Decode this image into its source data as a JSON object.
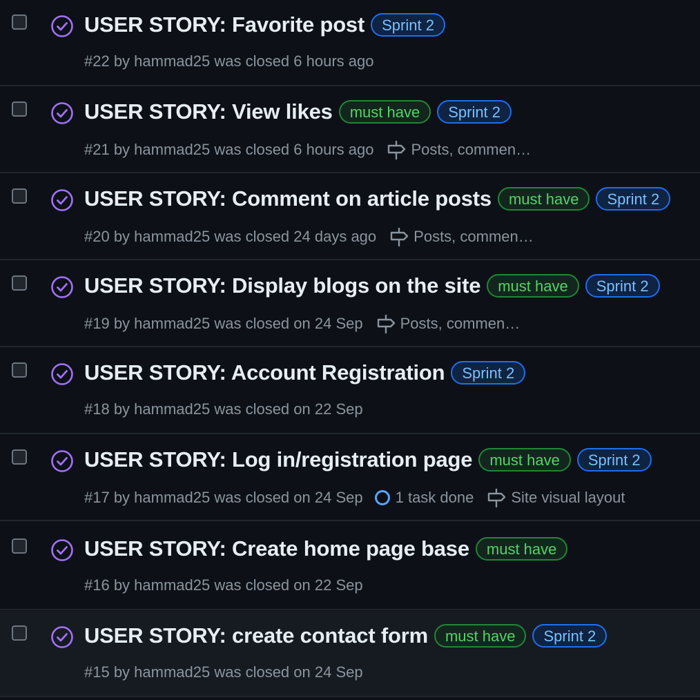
{
  "issues": [
    {
      "title": "USER STORY: Favorite post",
      "labels": [
        {
          "name": "Sprint 2",
          "color": "blue"
        }
      ],
      "meta": "#22 by hammad25 was closed 6 hours ago",
      "task": null,
      "milestone": null
    },
    {
      "title": "USER STORY: View likes",
      "labels": [
        {
          "name": "must have",
          "color": "green"
        },
        {
          "name": "Sprint 2",
          "color": "blue"
        }
      ],
      "meta": "#21 by hammad25 was closed 6 hours ago",
      "task": null,
      "milestone": "Posts, commen…"
    },
    {
      "title": "USER STORY: Comment on article posts",
      "labels": [
        {
          "name": "must have",
          "color": "green"
        },
        {
          "name": "Sprint 2",
          "color": "blue"
        }
      ],
      "meta": "#20 by hammad25 was closed 24 days ago",
      "task": null,
      "milestone": "Posts, commen…"
    },
    {
      "title": "USER STORY: Display blogs on the site",
      "labels": [
        {
          "name": "must have",
          "color": "green"
        },
        {
          "name": "Sprint 2",
          "color": "blue"
        }
      ],
      "meta": "#19 by hammad25 was closed on 24 Sep",
      "task": null,
      "milestone": "Posts, commen…"
    },
    {
      "title": "USER STORY: Account Registration",
      "labels": [
        {
          "name": "Sprint 2",
          "color": "blue"
        }
      ],
      "meta": "#18 by hammad25 was closed on 22 Sep",
      "task": null,
      "milestone": null
    },
    {
      "title": "USER STORY: Log in/registration page",
      "labels": [
        {
          "name": "must have",
          "color": "green"
        },
        {
          "name": "Sprint 2",
          "color": "blue"
        }
      ],
      "meta": "#17 by hammad25 was closed on 24 Sep",
      "task": "1 task done",
      "milestone": "Site visual layout"
    },
    {
      "title": "USER STORY: Create home page base",
      "labels": [
        {
          "name": "must have",
          "color": "green"
        }
      ],
      "meta": "#16 by hammad25 was closed on 22 Sep",
      "task": null,
      "milestone": null
    },
    {
      "title": "USER STORY: create contact form",
      "labels": [
        {
          "name": "must have",
          "color": "green"
        },
        {
          "name": "Sprint 2",
          "color": "blue"
        }
      ],
      "meta": "#15 by hammad25 was closed on 24 Sep",
      "task": null,
      "milestone": null
    }
  ],
  "icons": {
    "checkbox": "checkbox",
    "state": "issue-closed-icon",
    "task": "task-progress-icon",
    "milestone": "milestone-icon"
  },
  "colors": {
    "background": "#0d1117",
    "closed_purple": "#a371f7",
    "green_label": "#56d364",
    "blue_label": "#79c0ff"
  }
}
